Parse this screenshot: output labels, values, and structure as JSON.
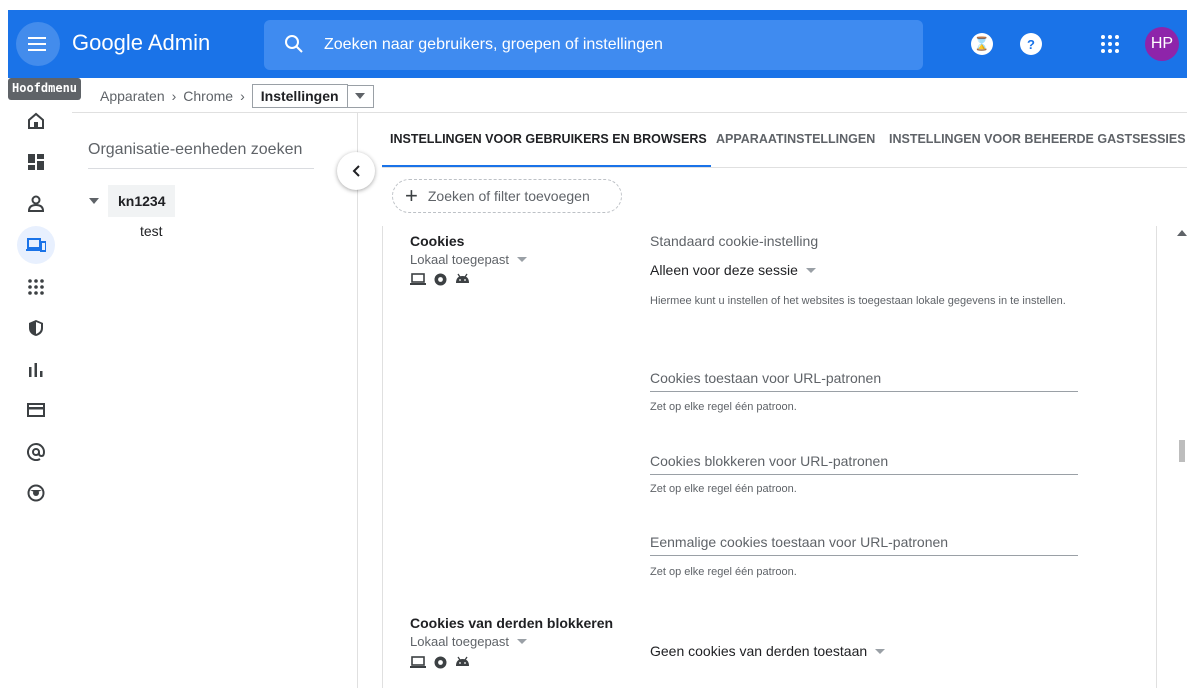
{
  "app": {
    "title": "Google Admin",
    "search_placeholder": "Zoeken naar gebruikers, groepen of instellingen",
    "avatar_initials": "HP",
    "menu_tooltip": "Hoofdmenu"
  },
  "breadcrumb": {
    "items": [
      "Apparaten",
      "Chrome"
    ],
    "separator": "›",
    "current": "Instellingen"
  },
  "left_pane": {
    "search_label": "Organisatie-eenheden zoeken",
    "root": "kn1234",
    "children": [
      "test"
    ]
  },
  "tabs": [
    {
      "label": "INSTELLINGEN VOOR GEBRUIKERS EN BROWSERS",
      "active": true
    },
    {
      "label": "APPARAATINSTELLINGEN",
      "active": false
    },
    {
      "label": "INSTELLINGEN VOOR BEHEERDE GASTSESSIES",
      "active": false
    }
  ],
  "filter": {
    "label": "Zoeken of filter toevoegen"
  },
  "settings": {
    "cookies": {
      "title": "Cookies",
      "applied": "Lokaal toegepast",
      "field_label": "Standaard cookie-instelling",
      "value": "Alleen voor deze sessie",
      "help": "Hiermee kunt u instellen of het websites is toegestaan lokale gegevens in te instellen.",
      "allow_urls": {
        "placeholder": "Cookies toestaan voor URL-patronen",
        "hint": "Zet op elke regel één patroon."
      },
      "block_urls": {
        "placeholder": "Cookies blokkeren voor URL-patronen",
        "hint": "Zet op elke regel één patroon."
      },
      "session_urls": {
        "placeholder": "Eenmalige cookies toestaan voor URL-patronen",
        "hint": "Zet op elke regel één patroon."
      }
    },
    "third_party": {
      "title": "Cookies van derden blokkeren",
      "applied": "Lokaal toegepast",
      "value": "Geen cookies van derden toestaan"
    }
  },
  "colors": {
    "brand_blue": "#1a73e8",
    "avatar": "#8e24aa"
  }
}
